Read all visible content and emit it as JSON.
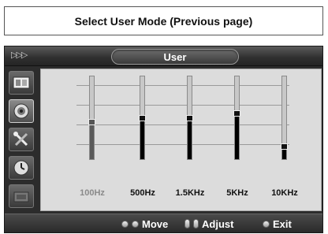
{
  "caption": "Select User Mode (Previous page)",
  "osd": {
    "title": "User",
    "nav_arrows": "▷▷▷",
    "sidebar": [
      {
        "icon": "picture-icon",
        "active": false
      },
      {
        "icon": "sound-icon",
        "active": true
      },
      {
        "icon": "setup-icon",
        "active": false
      },
      {
        "icon": "time-icon",
        "active": false
      },
      {
        "icon": "input-icon",
        "active": false
      }
    ],
    "equalizer": {
      "bands": [
        {
          "label": "100Hz",
          "level": 0.45,
          "selected": true
        },
        {
          "label": "500Hz",
          "level": 0.5,
          "selected": false
        },
        {
          "label": "1.5KHz",
          "level": 0.5,
          "selected": false
        },
        {
          "label": "5KHz",
          "level": 0.55,
          "selected": false
        },
        {
          "label": "10KHz",
          "level": 0.15,
          "selected": false
        }
      ]
    },
    "help": {
      "move": "Move",
      "adjust": "Adjust",
      "exit": "Exit"
    }
  },
  "colors": {
    "osd_background": "#2c2c2c",
    "panel_background": "#dcdcdc",
    "label_dim": "#8a8a8a"
  }
}
